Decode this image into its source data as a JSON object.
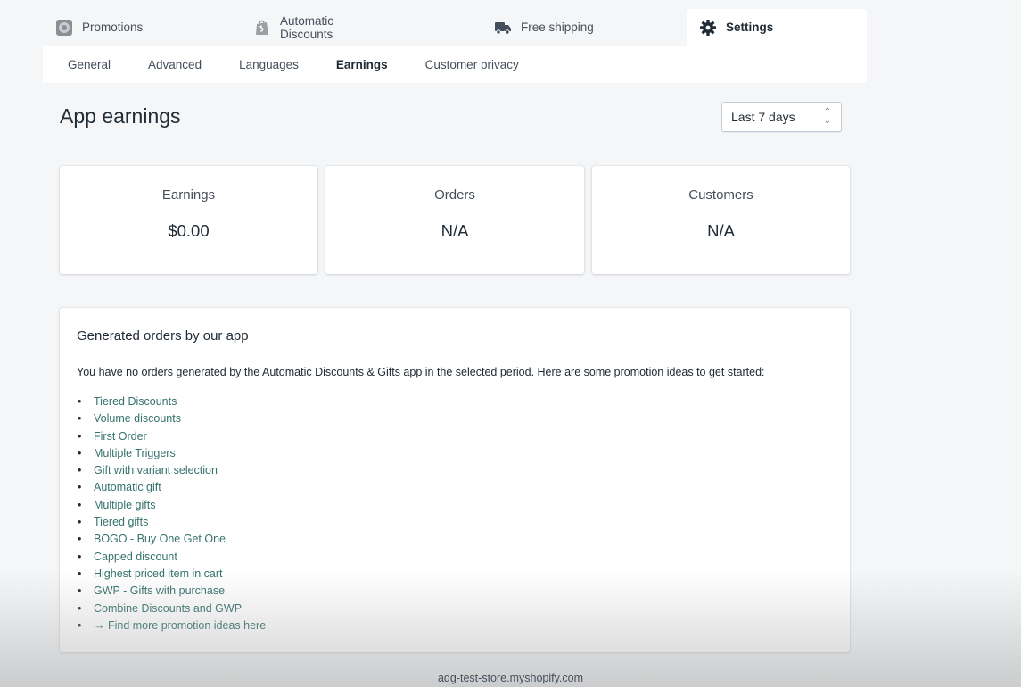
{
  "top_tabs": [
    {
      "label": "Promotions",
      "icon": "promotions-icon"
    },
    {
      "label": "Automatic Discounts",
      "icon": "shopify-bag-icon"
    },
    {
      "label": "Free shipping",
      "icon": "truck-icon"
    },
    {
      "label": "Settings",
      "icon": "gear-icon",
      "active": true
    }
  ],
  "sub_nav": [
    "General",
    "Advanced",
    "Languages",
    "Earnings",
    "Customer privacy"
  ],
  "sub_nav_active": "Earnings",
  "page": {
    "title": "App earnings",
    "period_select": "Last 7 days"
  },
  "stats": [
    {
      "label": "Earnings",
      "value": "$0.00"
    },
    {
      "label": "Orders",
      "value": "N/A"
    },
    {
      "label": "Customers",
      "value": "N/A"
    }
  ],
  "orders_card": {
    "title": "Generated orders by our app",
    "description": "You have no orders generated by the Automatic Discounts & Gifts app in the selected period. Here are some promotion ideas to get started:",
    "ideas": [
      "Tiered Discounts",
      "Volume discounts",
      "First Order",
      "Multiple Triggers",
      "Gift with variant selection",
      "Automatic gift",
      "Multiple gifts",
      "Tiered gifts",
      "BOGO - Buy One Get One",
      "Capped discount",
      "Highest priced item in cart",
      "GWP - Gifts with purchase",
      "Combine Discounts and GWP",
      "→ Find more promotion ideas here"
    ]
  },
  "footer": "adg-test-store.myshopify.com",
  "colors": {
    "background": "#f4f6f8",
    "link": "#34726b",
    "card": "#ffffff"
  }
}
